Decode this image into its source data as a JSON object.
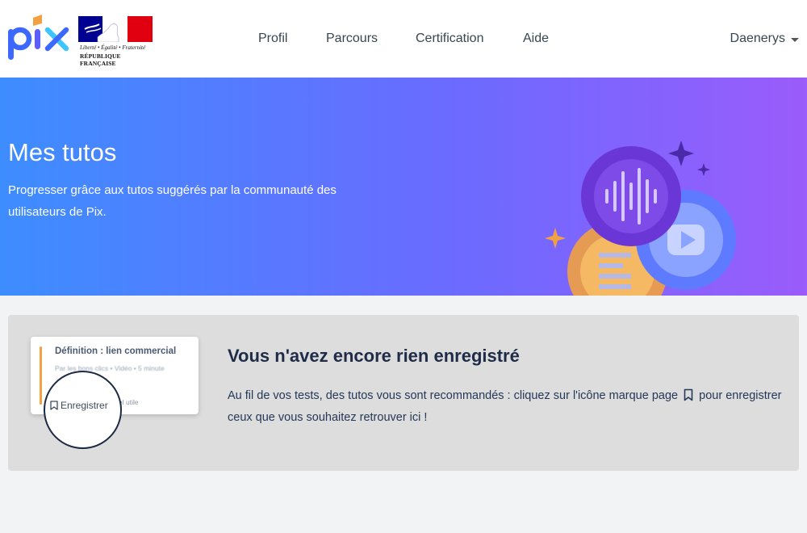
{
  "header": {
    "logo_text": "pix",
    "republic_motto": "Liberté • Égalité • Fraternité",
    "republic_name": "RÉPUBLIQUE FRANÇAISE",
    "nav": [
      {
        "label": "Profil"
      },
      {
        "label": "Parcours"
      },
      {
        "label": "Certification"
      },
      {
        "label": "Aide"
      }
    ],
    "user_name": "Daenerys"
  },
  "banner": {
    "title": "Mes tutos",
    "description": "Progresser grâce aux tutos suggérés par la communauté des utilisateurs de Pix."
  },
  "empty_state": {
    "sample_card": {
      "title": "Définition : lien commercial",
      "meta": "Par les bons clics • Vidéo • 5 minute",
      "useful_label": "el utile",
      "save_label": "Enregistrer"
    },
    "title": "Vous n'avez encore rien enregistré",
    "text_before_icon": "Au fil de vos tests, des tutos vous sont recommandés : cliquez sur l'icône marque page",
    "text_after_icon": "pour enregistrer ceux que vous souhaitez retrouver ici !"
  },
  "colors": {
    "banner_start": "#3d8dff",
    "banner_end": "#9a5cfb",
    "card_background": "#dddddd",
    "accent_orange": "#f1a141"
  }
}
